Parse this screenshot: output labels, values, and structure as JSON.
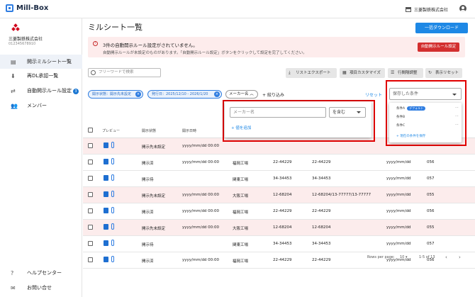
{
  "app": {
    "logo_text": "Mill-Box",
    "company": "三菱製鉄株式会社",
    "company_id": "012345678910"
  },
  "sidebar": {
    "items": [
      {
        "label": "開示ミルシート一覧",
        "icon": "doc-list-icon",
        "active": true
      },
      {
        "label": "再DL承認一覧",
        "icon": "download-icon",
        "active": false
      },
      {
        "label": "自動開示ルール設定",
        "icon": "swap-icon",
        "badge": "3",
        "active": false
      },
      {
        "label": "メンバー",
        "icon": "people-icon",
        "active": false
      }
    ],
    "help": "ヘルプセンター",
    "contact": "お問い合せ"
  },
  "page": {
    "title": "ミルシート一覧",
    "download_btn": "一括ダウンロード"
  },
  "alert": {
    "title": "3件の自動開示ルール設定がされていません。",
    "body": "自動開示ルールが未設定のものがあります。「自動開示ルール設定」ボタンをクリックして設定を完了してください。",
    "button": "自動開示ルール設定"
  },
  "toolbar": {
    "search_placeholder": "フリーワードで検索",
    "export": "リストエクスポート",
    "customize": "項目カスタマイズ",
    "columns": "行間隔調整",
    "reset_view": "表示リセット"
  },
  "filters": {
    "chip1": "開示状態：開示先未設定",
    "chip2": "発行日：2025/12/10 - 2026/1/20",
    "chip3": "メーカー名",
    "add": "絞り込み",
    "reset": "リセット"
  },
  "maker_popup": {
    "placeholder": "メーカー名",
    "operator": "を含む",
    "add_value": "値を追加"
  },
  "saved_popup": {
    "label": "保存した条件",
    "default_tag": "デフォルト",
    "items": [
      "条件A",
      "条件B",
      "条件C"
    ],
    "save_current": "現在の条件を保存"
  },
  "table": {
    "headers": [
      "プレビュー",
      "開示状態",
      "開示日時",
      "",
      "",
      "",
      ""
    ],
    "rows": [
      {
        "status": "開示先未設定",
        "date": "yyyy/mm/dd 00:00",
        "plant": "",
        "code": "",
        "ref": "",
        "issue": "",
        "num": "",
        "pink": true
      },
      {
        "status": "開示済",
        "date": "yyyy/mm/dd 00:00",
        "plant": "福岡工場",
        "code": "22-44229",
        "ref": "22-44229",
        "issue": "yyyy/mm/dd",
        "num": "056",
        "pink": false
      },
      {
        "status": "開示待",
        "date": "",
        "plant": "関東工場",
        "code": "34-34453",
        "ref": "34-34453",
        "issue": "yyyy/mm/dd",
        "num": "057",
        "pink": false
      },
      {
        "status": "開示先未設定",
        "date": "yyyy/mm/dd 00:00",
        "plant": "大阪工場",
        "code": "12-68204",
        "ref": "12-68204/13-77777/13-77777",
        "issue": "yyyy/mm/dd",
        "num": "055",
        "pink": true
      },
      {
        "status": "開示済",
        "date": "yyyy/mm/dd 00:00",
        "plant": "福岡工場",
        "code": "22-44229",
        "ref": "22-44229",
        "issue": "yyyy/mm/dd",
        "num": "056",
        "pink": false
      },
      {
        "status": "開示先未設定",
        "date": "yyyy/mm/dd 00:00",
        "plant": "大阪工場",
        "code": "12-68204",
        "ref": "12-68204",
        "issue": "yyyy/mm/dd",
        "num": "055",
        "pink": true
      },
      {
        "status": "開示待",
        "date": "",
        "plant": "関東工場",
        "code": "34-34453",
        "ref": "34-34453",
        "issue": "yyyy/mm/dd",
        "num": "057",
        "pink": false
      },
      {
        "status": "開示済",
        "date": "yyyy/mm/dd 00:00",
        "plant": "福岡工場",
        "code": "22-44229",
        "ref": "22-44229",
        "issue": "yyyy/mm/dd",
        "num": "056",
        "pink": false
      }
    ]
  },
  "pager": {
    "rows_label": "Rows per page:",
    "rows_value": "10",
    "range": "1-5 of 13"
  }
}
